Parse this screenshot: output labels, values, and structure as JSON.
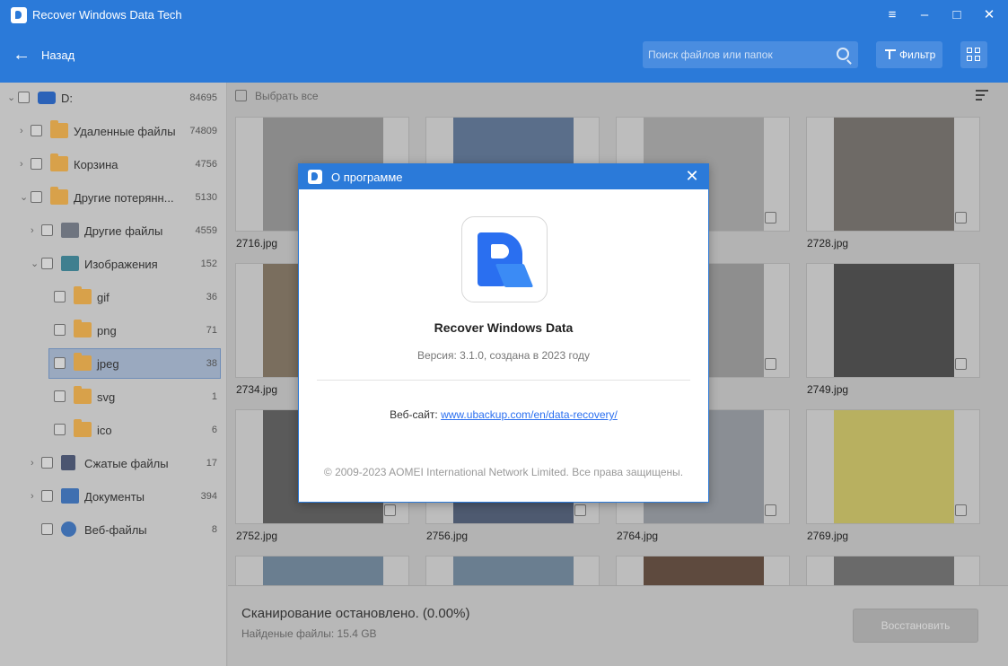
{
  "app": {
    "title": "Recover Windows Data Tech",
    "window_controls": [
      "menu-icon",
      "minimize-icon",
      "maximize-icon",
      "close-icon"
    ]
  },
  "nav": {
    "back_label": "Назад",
    "search_placeholder": "Поиск файлов или папок",
    "filter_label": "Фильтр"
  },
  "sidebar": {
    "items": [
      {
        "label": "D:",
        "count": "84695",
        "icon": "drive-icon",
        "level": 0,
        "expand": "expanded"
      },
      {
        "label": "Удаленные файлы",
        "count": "74809",
        "icon": "deleted-folder-icon",
        "level": 1,
        "expand": "collapsed"
      },
      {
        "label": "Корзина",
        "count": "4756",
        "icon": "recycle-bin-icon",
        "level": 1,
        "expand": "collapsed"
      },
      {
        "label": "Другие потерянн...",
        "count": "5130",
        "icon": "lost-folder-icon",
        "level": 1,
        "expand": "expanded"
      },
      {
        "label": "Другие файлы",
        "count": "4559",
        "icon": "other-files-icon",
        "level": 2,
        "expand": "collapsed"
      },
      {
        "label": "Изображения",
        "count": "152",
        "icon": "images-icon",
        "level": 2,
        "expand": "expanded"
      },
      {
        "label": "gif",
        "count": "36",
        "icon": "folder-icon",
        "level": 3,
        "expand": "none"
      },
      {
        "label": "png",
        "count": "71",
        "icon": "folder-icon",
        "level": 3,
        "expand": "none"
      },
      {
        "label": "jpeg",
        "count": "38",
        "icon": "folder-icon",
        "level": 3,
        "expand": "none",
        "selected": true
      },
      {
        "label": "svg",
        "count": "1",
        "icon": "folder-icon",
        "level": 3,
        "expand": "none"
      },
      {
        "label": "ico",
        "count": "6",
        "icon": "folder-icon",
        "level": 3,
        "expand": "none"
      },
      {
        "label": "Сжатые файлы",
        "count": "17",
        "icon": "archive-icon",
        "level": 2,
        "expand": "collapsed"
      },
      {
        "label": "Документы",
        "count": "394",
        "icon": "documents-icon",
        "level": 2,
        "expand": "collapsed"
      },
      {
        "label": "Веб-файлы",
        "count": "8",
        "icon": "web-files-icon",
        "level": 2,
        "expand": "none"
      }
    ]
  },
  "content": {
    "select_all_label": "Выбрать все",
    "files": [
      {
        "name": "2716.jpg"
      },
      {
        "name": ""
      },
      {
        "name": ""
      },
      {
        "name": "2728.jpg"
      },
      {
        "name": "2734.jpg"
      },
      {
        "name": ""
      },
      {
        "name": ""
      },
      {
        "name": "2749.jpg"
      },
      {
        "name": "2752.jpg"
      },
      {
        "name": "2756.jpg"
      },
      {
        "name": "2764.jpg"
      },
      {
        "name": "2769.jpg"
      },
      {
        "name": ""
      },
      {
        "name": ""
      },
      {
        "name": ""
      },
      {
        "name": ""
      }
    ]
  },
  "footer": {
    "scan_status": "Сканирование остановлено. (0.00%)",
    "found_files": "Найденые файлы: 15.4 GB",
    "restore_label": "Восстановить"
  },
  "about_dialog": {
    "title": "О программе",
    "product_name": "Recover Windows Data",
    "version": "Версия: 3.1.0, создана в 2023 году",
    "website_label": "Веб-сайт:",
    "website_url": "www.ubackup.com/en/data-recovery/",
    "copyright": "© 2009-2023 AOMEI International Network Limited. Все права защищены."
  },
  "colors": {
    "accent": "#2b7ad9",
    "overlay_dim": "#b3b3b3",
    "logo_blue": "#2a6ff0"
  }
}
